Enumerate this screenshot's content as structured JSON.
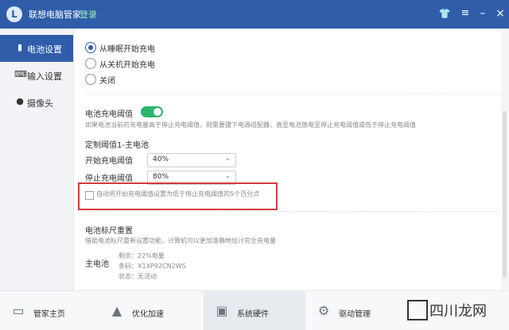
{
  "titlebar": {
    "app_title": "联想电脑管家",
    "login_label": "登录",
    "icons": [
      "shirt-icon",
      "menu-icon",
      "minimize-icon",
      "close-icon"
    ]
  },
  "sidebar": {
    "items": [
      {
        "label": "电池设置",
        "icon": "battery-icon",
        "active": true
      },
      {
        "label": "输入设置",
        "icon": "keyboard-icon",
        "active": false
      },
      {
        "label": "摄像头",
        "icon": "camera-icon",
        "active": false
      }
    ]
  },
  "main": {
    "charge_options": [
      {
        "label": "从睡眠开始充电",
        "checked": true
      },
      {
        "label": "从关机开始充电",
        "checked": false
      },
      {
        "label": "关闭",
        "checked": false
      }
    ],
    "threshold": {
      "title": "电池充电阈值",
      "enabled": true,
      "description": "如果电池当前的充电量高于停止充电阈值，则需要拔下电源适配器，直至电池放电至停止充电阈值或低于停止充电阈值",
      "custom_title": "定制阈值1-主电池",
      "start_label": "开始充电阈值",
      "start_value": "40%",
      "stop_label": "停止充电阈值",
      "stop_value": "80%",
      "auto_checkbox_label": "自动将开始充电阈值设置为低于停止充电阈值的5个百分点"
    },
    "calibration": {
      "title": "电池标尺重置",
      "description": "借助电池标尺重新设置功能，计算机可以更加准确地估计完全充电量",
      "battery_label": "主电池",
      "remaining": "剩余：22%电量",
      "barcode": "条码：X1XP92CN2WS",
      "status": "状态：无活动"
    }
  },
  "bottombar": {
    "items": [
      {
        "label": "管家主页",
        "icon": "monitor-icon"
      },
      {
        "label": "优化加速",
        "icon": "rocket-icon"
      },
      {
        "label": "系统硬件",
        "icon": "chip-icon",
        "active": true
      },
      {
        "label": "驱动管理",
        "icon": "gear-icon"
      }
    ]
  },
  "watermark": {
    "text": "四川龙网"
  },
  "colors": {
    "titlebar": "#2f5daa",
    "active": "#2f5daa",
    "toggle_on": "#2cb56a",
    "highlight": "#d33a3a"
  }
}
